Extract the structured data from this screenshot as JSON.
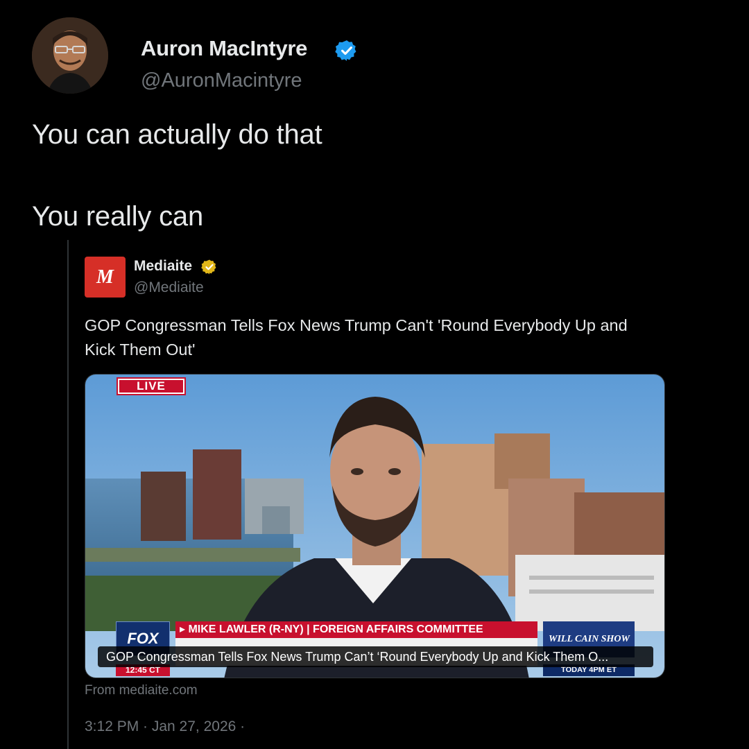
{
  "author": {
    "name": "Auron MacIntyre",
    "handle": "@AuronMacintyre"
  },
  "tweet": {
    "lines": [
      "You can actually do that",
      "You really can"
    ]
  },
  "quote": {
    "logo_letter": "M",
    "name": "Mediaite",
    "handle": "@Mediaite",
    "headline": "GOP Congressman Tells Fox News Trump Can't 'Round Everybody Up and Kick Them Out'",
    "media": {
      "live_badge": "LIVE",
      "network_logo": "FOX",
      "chyron_time": "12:45 CT",
      "chyron_name": "▸ MIKE LAWLER (R-NY) | FOREIGN AFFAIRS COMMITTEE",
      "show_promo": "WILL CAIN SHOW",
      "show_time": "TODAY 4PM ET",
      "caption": "GOP Congressman Tells Fox News Trump Can’t ‘Round Everybody Up and Kick Them O..."
    },
    "source": "From mediaite.com"
  },
  "meta": {
    "timestamp": "3:12 PM · Jan 27, 2026 ·"
  },
  "colors": {
    "background": "#000000",
    "text_primary": "#e7e9ea",
    "text_secondary": "#71767b",
    "verified_blue": "#1d9bf0",
    "verified_gold": "#e2b719",
    "mediaite_red": "#d62f27",
    "fox_red": "#c8102e"
  },
  "icons": {
    "verified_author": "verified-badge-icon",
    "verified_quote": "verified-gold-badge-icon"
  }
}
